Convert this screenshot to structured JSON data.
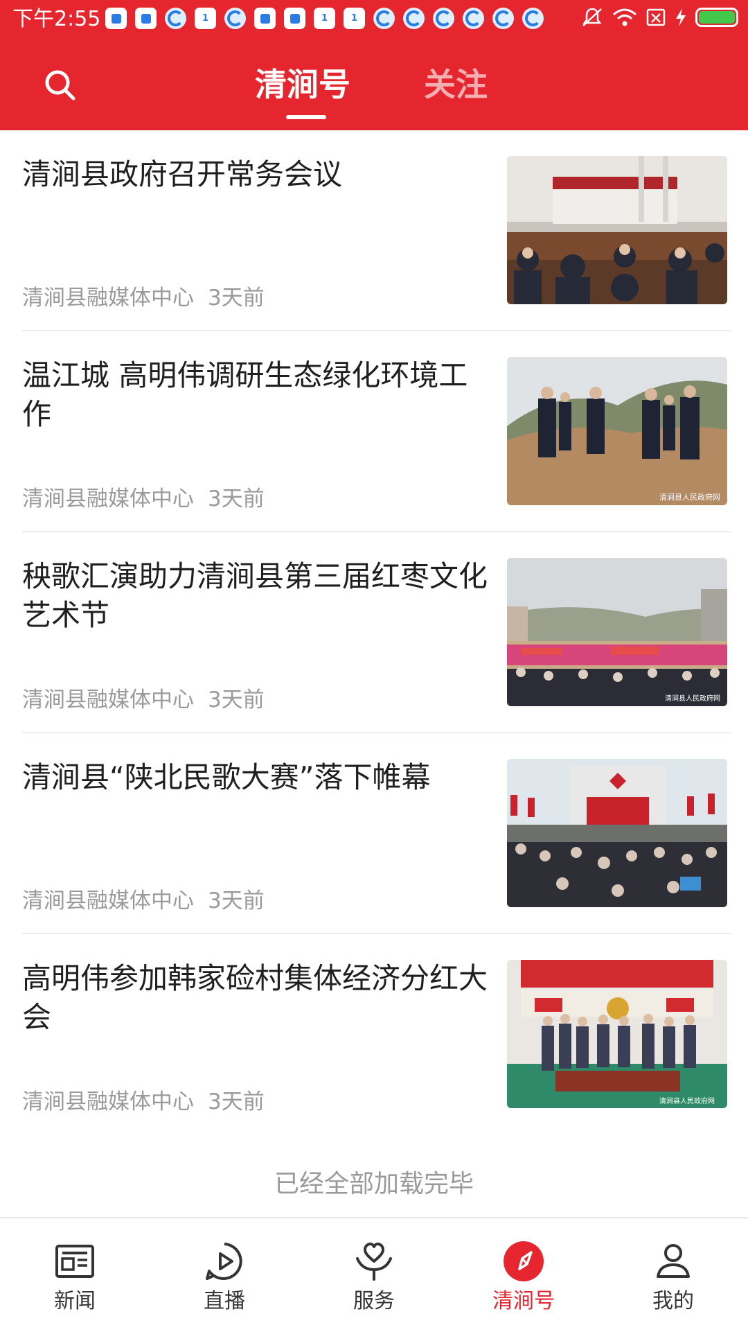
{
  "status_bar": {
    "time": "下午2:55",
    "notification_icons": [
      "note-app-icon",
      "note-app-icon",
      "browser-icon",
      "im-app-icon",
      "browser-icon",
      "note-app-icon",
      "note-app-icon",
      "im-app-icon",
      "im-app-icon",
      "browser-icon",
      "browser-icon",
      "browser-icon",
      "browser-icon",
      "browser-icon",
      "browser-icon"
    ],
    "system_icons": [
      "mute-icon",
      "wifi-icon",
      "no-sim-icon",
      "charging-icon",
      "battery-icon"
    ],
    "battery_level": 1.0,
    "battery_color": "#43c84b"
  },
  "header": {
    "accent": "#e5262f",
    "tabs": [
      {
        "label": "清涧号",
        "active": true
      },
      {
        "label": "关注",
        "active": false
      }
    ]
  },
  "articles": [
    {
      "title": "清涧县政府召开常务会议",
      "source": "清涧县融媒体中心",
      "time": "3天前",
      "image": "meeting-photo"
    },
    {
      "title": "温江城 高明伟调研生态绿化环境工作",
      "source": "清涧县融媒体中心",
      "time": "3天前",
      "image": "hillside-inspection-photo",
      "watermark": "清涧县人民政府网"
    },
    {
      "title": "秧歌汇演助力清涧县第三届红枣文化艺术节",
      "source": "清涧县融媒体中心",
      "time": "3天前",
      "image": "yangko-performance-photo",
      "watermark": "清涧县人民政府网"
    },
    {
      "title": "清涧县“陕北民歌大赛”落下帷幕",
      "source": "清涧县融媒体中心",
      "time": "3天前",
      "image": "folk-song-stage-photo"
    },
    {
      "title": "高明伟参加韩家硷村集体经济分红大会",
      "source": "清涧县融媒体中心",
      "time": "3天前",
      "image": "dividend-meeting-photo",
      "watermark": "清涧县人民政府网"
    }
  ],
  "footer_message": "已经全部加载完毕",
  "bottom_nav": [
    {
      "label": "新闻",
      "icon": "newspaper-icon",
      "active": false
    },
    {
      "label": "直播",
      "icon": "play-circle-icon",
      "active": false
    },
    {
      "label": "服务",
      "icon": "heart-hand-icon",
      "active": false
    },
    {
      "label": "清涧号",
      "icon": "compass-icon",
      "active": true
    },
    {
      "label": "我的",
      "icon": "person-icon",
      "active": false
    }
  ]
}
